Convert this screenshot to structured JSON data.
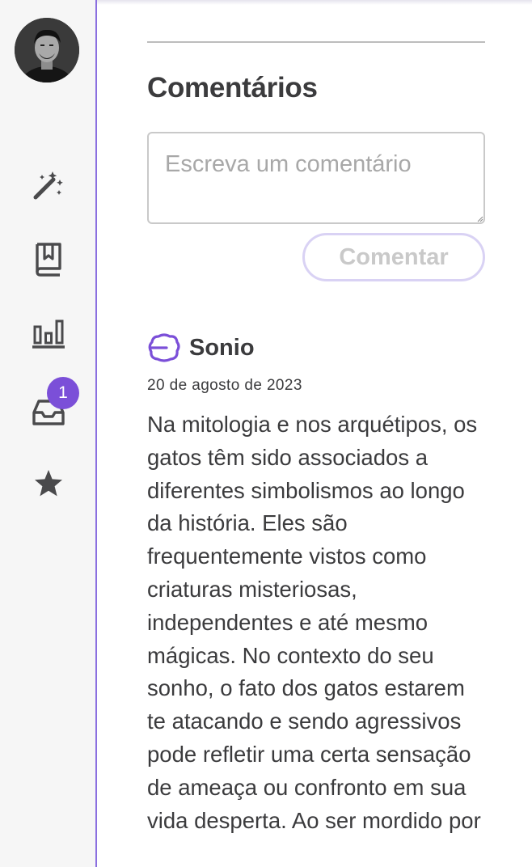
{
  "sidebar": {
    "avatar_alt": "Foto do usuário",
    "items": [
      {
        "icon": "magic-wand-icon"
      },
      {
        "icon": "book-bookmark-icon"
      },
      {
        "icon": "bar-chart-icon"
      },
      {
        "icon": "inbox-icon",
        "badge": "1"
      },
      {
        "icon": "star-icon"
      }
    ],
    "accent_color": "#7b4fd8"
  },
  "comments": {
    "title": "Comentários",
    "input_placeholder": "Escreva um comentário",
    "submit_label": "Comentar",
    "items": [
      {
        "author": "Sonio",
        "author_icon": "sonio-logo-icon",
        "date": "20 de agosto de 2023",
        "text": "Na mitologia e nos arquétipos, os gatos têm sido associados a diferentes simbolismos ao longo da história. Eles são frequentemente vistos como criaturas misteriosas, independentes e até mesmo mágicas. No contexto do seu sonho, o fato dos gatos estarem te atacando e sendo agressivos pode refletir uma certa sensação de ameaça ou confronto em sua vida desperta. Ao ser mordido por"
      }
    ]
  }
}
